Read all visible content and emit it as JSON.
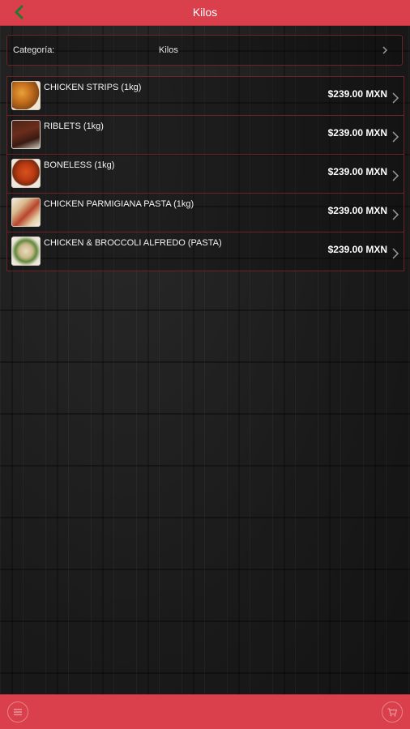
{
  "header": {
    "title": "Kilos",
    "back_icon": "chevron-left-icon",
    "accent_color": "#d9404c"
  },
  "category": {
    "label": "Categoría:",
    "value": "Kilos",
    "icon": "chevron-right-icon"
  },
  "items": [
    {
      "name": "CHICKEN STRIPS (1kg)",
      "price": "$239.00 MXN",
      "thumb_icon": "chicken-strips-photo"
    },
    {
      "name": "RIBLETS (1kg)",
      "price": "$239.00 MXN",
      "thumb_icon": "riblets-photo"
    },
    {
      "name": "BONELESS (1kg)",
      "price": "$239.00 MXN",
      "thumb_icon": "boneless-photo"
    },
    {
      "name": "CHICKEN PARMIGIANA PASTA (1kg)",
      "price": "$239.00 MXN",
      "thumb_icon": "parmigiana-pasta-photo"
    },
    {
      "name": "CHICKEN & BROCCOLI ALFREDO (PASTA)",
      "price": "$239.00 MXN",
      "thumb_icon": "alfredo-pasta-photo"
    }
  ],
  "footer": {
    "left_icon": "menu-circle-icon",
    "right_icon": "cart-circle-icon"
  }
}
